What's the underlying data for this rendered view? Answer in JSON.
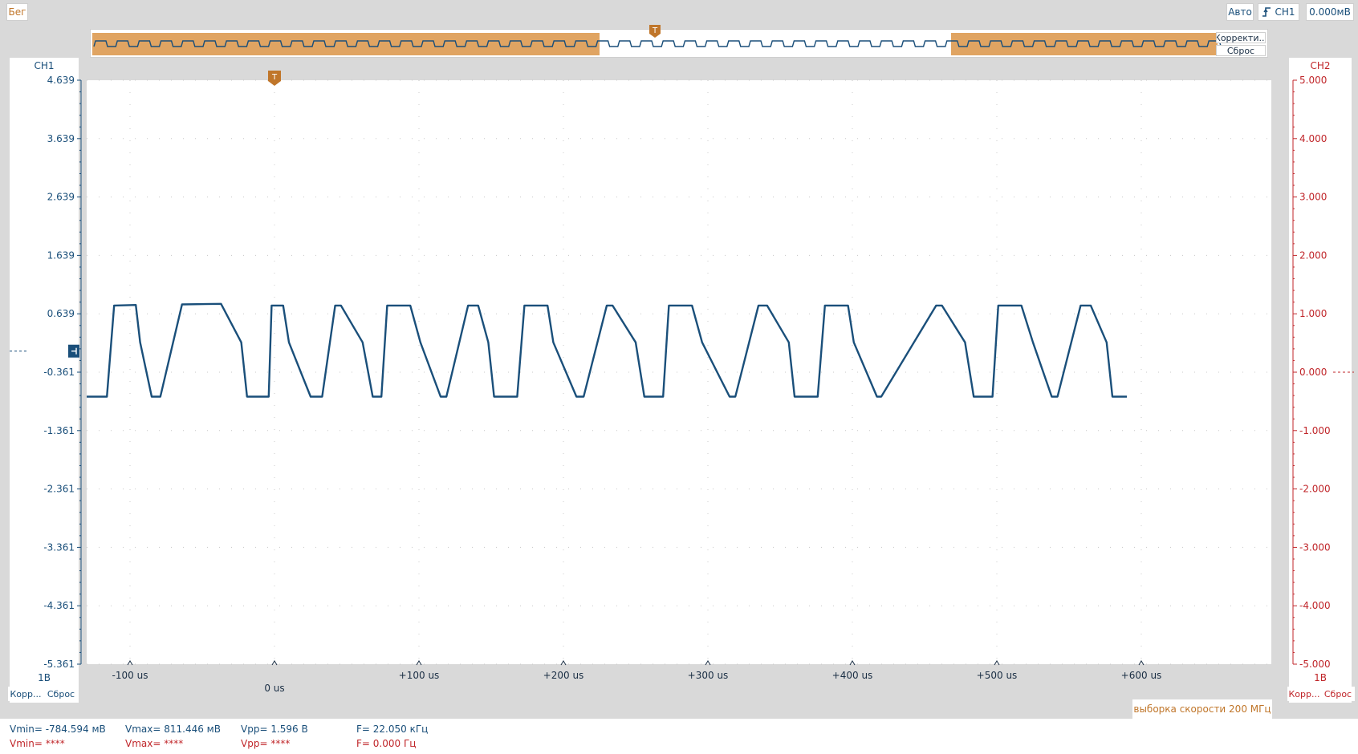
{
  "status": {
    "run_label": "Бег"
  },
  "trigger": {
    "mode_label": "Авто",
    "source_label": "CH1",
    "level_label": "0.000мВ",
    "marker_glyph": "T"
  },
  "overview": {
    "correct_label": "Корректи...",
    "reset_label": "Сброс"
  },
  "channels": {
    "ch1": {
      "label": "CH1",
      "scale_label": "1В",
      "correct_label": "Корр...",
      "reset_label": "Сброс",
      "color": "#1a4f7a",
      "ticks": [
        "4.639",
        "3.639",
        "2.639",
        "1.639",
        "0.639",
        "-0.361",
        "-1.361",
        "-2.361",
        "-3.361",
        "-4.361",
        "-5.361"
      ]
    },
    "ch2": {
      "label": "CH2",
      "scale_label": "1В",
      "correct_label": "Корр...",
      "reset_label": "Сброс",
      "color": "#c0262a",
      "ticks": [
        "5.000",
        "4.000",
        "3.000",
        "2.000",
        "1.000",
        "0.000",
        "-1.000",
        "-2.000",
        "-3.000",
        "-4.000",
        "-5.000"
      ]
    }
  },
  "time_axis": {
    "labels": [
      "-100 us",
      "0 us",
      "+100 us",
      "+200 us",
      "+300 us",
      "+400 us",
      "+500 us",
      "+600 us"
    ]
  },
  "sample_rate_label": "выборка скорости 200 МГц",
  "measurements": {
    "ch1": {
      "vmin": "Vmin= -784.594 мВ",
      "vmax": "Vmax= 811.446 мВ",
      "vpp": "Vpp= 1.596 В",
      "freq": "F= 22.050 кГц"
    },
    "ch2": {
      "vmin": "Vmin= ****",
      "vmax": "Vmax= ****",
      "vpp": "Vpp= ****",
      "freq": "F= 0.000 Гц"
    }
  },
  "chart_data": {
    "type": "line",
    "series": [
      {
        "name": "CH1",
        "x_unit": "us",
        "y_unit": "V",
        "x": [
          -130,
          -116,
          -111,
          -96,
          -93,
          -85,
          -79,
          -64,
          -37,
          -23,
          -19,
          -4,
          -2,
          6,
          10,
          25,
          33,
          42,
          46,
          61,
          68,
          74,
          78,
          94,
          101,
          115,
          119,
          134,
          141,
          148,
          152,
          168,
          173,
          189,
          193,
          209,
          214,
          230,
          234,
          250,
          256,
          269,
          273,
          289,
          296,
          315,
          319,
          335,
          341,
          356,
          360,
          376,
          381,
          397,
          401,
          417,
          420,
          458,
          462,
          478,
          484,
          497,
          501,
          517,
          525,
          538,
          542,
          558,
          565,
          576,
          580,
          590
        ],
        "y": [
          -0.78,
          -0.78,
          0.78,
          0.79,
          0.15,
          -0.78,
          -0.78,
          0.8,
          0.81,
          0.15,
          -0.78,
          -0.78,
          0.78,
          0.78,
          0.15,
          -0.78,
          -0.78,
          0.78,
          0.78,
          0.15,
          -0.78,
          -0.78,
          0.78,
          0.78,
          0.15,
          -0.78,
          -0.78,
          0.78,
          0.78,
          0.15,
          -0.78,
          -0.78,
          0.78,
          0.78,
          0.15,
          -0.78,
          -0.78,
          0.78,
          0.78,
          0.15,
          -0.78,
          -0.78,
          0.78,
          0.78,
          0.15,
          -0.78,
          -0.78,
          0.78,
          0.78,
          0.15,
          -0.78,
          -0.78,
          0.78,
          0.78,
          0.15,
          -0.78,
          -0.78,
          0.78,
          0.78,
          0.15,
          -0.78,
          -0.78,
          0.78,
          0.78,
          0.15,
          -0.78,
          -0.78,
          0.78,
          0.78,
          0.15,
          -0.78,
          -0.78
        ]
      }
    ],
    "ch1_axis": {
      "ylim": [
        -5.361,
        4.639
      ],
      "ticks": [
        4.639,
        3.639,
        2.639,
        1.639,
        0.639,
        -0.361,
        -1.361,
        -2.361,
        -3.361,
        -4.361,
        -5.361
      ]
    },
    "ch2_axis": {
      "ylim": [
        -5.0,
        5.0
      ],
      "ticks": [
        5,
        4,
        3,
        2,
        1,
        0,
        -1,
        -2,
        -3,
        -4,
        -5
      ]
    },
    "xlim": [
      -130,
      690
    ],
    "x_ticks": [
      -100,
      0,
      100,
      200,
      300,
      400,
      500,
      600
    ],
    "grid": true,
    "trigger_time": 0,
    "trigger_level_ch1": 0.0,
    "ch2_level": 0.0
  }
}
